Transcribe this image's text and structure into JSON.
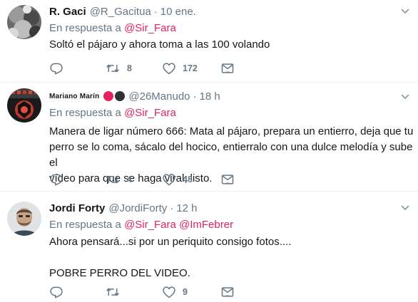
{
  "tweets": [
    {
      "name": "R. Gaci",
      "handle": "@R_Gacitua",
      "separator": "·",
      "time": "10 ene.",
      "reply_prefix": "En respuesta a",
      "reply_mentions": [
        "@Sir_Fara"
      ],
      "text": "Soltó el pájaro y ahora toma a las 100 volando",
      "retweets": "8",
      "likes": "172"
    },
    {
      "name": "Mariano Marín",
      "handle": "@26Manudo",
      "separator": "·",
      "time": "18 h",
      "reply_prefix": "En respuesta a",
      "reply_mentions": [
        "@Sir_Fara"
      ],
      "text_lines": [
        "Manera de ligar número 666: Mata al pájaro, prepara un entierro, deja que tu",
        "perro se lo coma, sácalo del hocico, entierralo con una dulce melodía y sube el",
        "vídeo para que se haga viral, listo."
      ],
      "retweets": "4",
      "likes": "48"
    },
    {
      "name": "Jordi Forty",
      "handle": "@JordiForty",
      "separator": "·",
      "time": "12 h",
      "reply_prefix": "En respuesta a",
      "reply_mentions": [
        "@Sir_Fara",
        "@ImFebrer"
      ],
      "text_lines": [
        "Ahora pensará...si por un periquito consigo fotos....",
        "",
        "POBRE PERRO DEL VIDEO."
      ],
      "retweets": "",
      "likes": "9"
    }
  ],
  "colors": {
    "mention": "#e0245e",
    "secondary_text": "#657786",
    "divider": "#e6ecf0",
    "badge_red": "#e0245e",
    "badge_dark": "#2f3336"
  },
  "icons": [
    "reply-icon",
    "retweet-icon",
    "like-icon",
    "message-icon",
    "chevron-down-icon"
  ]
}
